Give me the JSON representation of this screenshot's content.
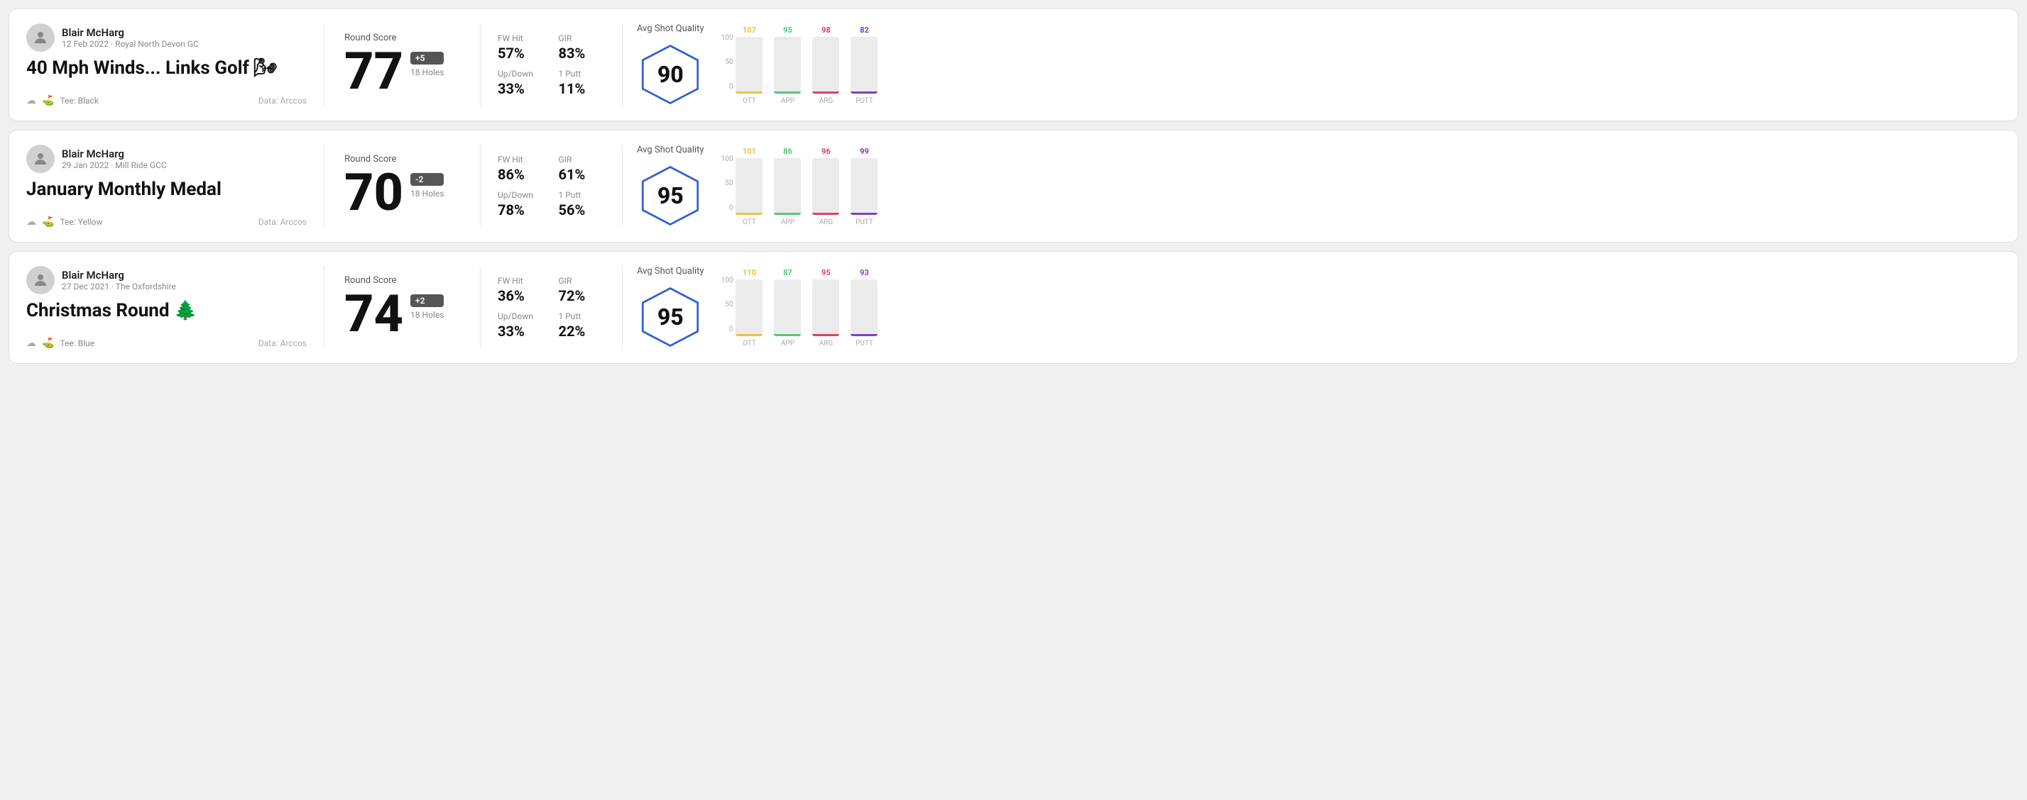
{
  "rounds": [
    {
      "id": "round1",
      "user": {
        "name": "Blair McHarg",
        "date_course": "12 Feb 2022 · Royal North Devon GC"
      },
      "title": "40 Mph Winds... Links Golf 🌬",
      "tee": "Black",
      "data_source": "Data: Arccos",
      "score": {
        "value": "77",
        "modifier": "+5",
        "holes": "18 Holes"
      },
      "stats": {
        "fw_hit_label": "FW Hit",
        "fw_hit_value": "57%",
        "gir_label": "GIR",
        "gir_value": "83%",
        "updown_label": "Up/Down",
        "updown_value": "33%",
        "oneputt_label": "1 Putt",
        "oneputt_value": "11%"
      },
      "shot_quality": {
        "label": "Avg Shot Quality",
        "score": "90"
      },
      "chart": {
        "bars": [
          {
            "label": "OTT",
            "value": 107,
            "color_class": "bg-ott",
            "text_class": "color-ott"
          },
          {
            "label": "APP",
            "value": 95,
            "color_class": "bg-app",
            "text_class": "color-app"
          },
          {
            "label": "ARG",
            "value": 98,
            "color_class": "bg-arg",
            "text_class": "color-arg"
          },
          {
            "label": "PUTT",
            "value": 82,
            "color_class": "bg-putt",
            "text_class": "color-putt"
          }
        ]
      }
    },
    {
      "id": "round2",
      "user": {
        "name": "Blair McHarg",
        "date_course": "29 Jan 2022 · Mill Ride GCC"
      },
      "title": "January Monthly Medal",
      "tee": "Yellow",
      "data_source": "Data: Arccos",
      "score": {
        "value": "70",
        "modifier": "-2",
        "holes": "18 Holes"
      },
      "stats": {
        "fw_hit_label": "FW Hit",
        "fw_hit_value": "86%",
        "gir_label": "GIR",
        "gir_value": "61%",
        "updown_label": "Up/Down",
        "updown_value": "78%",
        "oneputt_label": "1 Putt",
        "oneputt_value": "56%"
      },
      "shot_quality": {
        "label": "Avg Shot Quality",
        "score": "95"
      },
      "chart": {
        "bars": [
          {
            "label": "OTT",
            "value": 101,
            "color_class": "bg-ott",
            "text_class": "color-ott"
          },
          {
            "label": "APP",
            "value": 86,
            "color_class": "bg-app",
            "text_class": "color-app"
          },
          {
            "label": "ARG",
            "value": 96,
            "color_class": "bg-arg",
            "text_class": "color-arg"
          },
          {
            "label": "PUTT",
            "value": 99,
            "color_class": "bg-putt",
            "text_class": "color-putt"
          }
        ]
      }
    },
    {
      "id": "round3",
      "user": {
        "name": "Blair McHarg",
        "date_course": "27 Dec 2021 · The Oxfordshire"
      },
      "title": "Christmas Round 🌲",
      "tee": "Blue",
      "data_source": "Data: Arccos",
      "score": {
        "value": "74",
        "modifier": "+2",
        "holes": "18 Holes"
      },
      "stats": {
        "fw_hit_label": "FW Hit",
        "fw_hit_value": "36%",
        "gir_label": "GIR",
        "gir_value": "72%",
        "updown_label": "Up/Down",
        "updown_value": "33%",
        "oneputt_label": "1 Putt",
        "oneputt_value": "22%"
      },
      "shot_quality": {
        "label": "Avg Shot Quality",
        "score": "95"
      },
      "chart": {
        "bars": [
          {
            "label": "OTT",
            "value": 110,
            "color_class": "bg-ott",
            "text_class": "color-ott"
          },
          {
            "label": "APP",
            "value": 87,
            "color_class": "bg-app",
            "text_class": "color-app"
          },
          {
            "label": "ARG",
            "value": 95,
            "color_class": "bg-arg",
            "text_class": "color-arg"
          },
          {
            "label": "PUTT",
            "value": 93,
            "color_class": "bg-putt",
            "text_class": "color-putt"
          }
        ]
      }
    }
  ],
  "y_axis_labels": [
    "100",
    "50",
    "0"
  ]
}
